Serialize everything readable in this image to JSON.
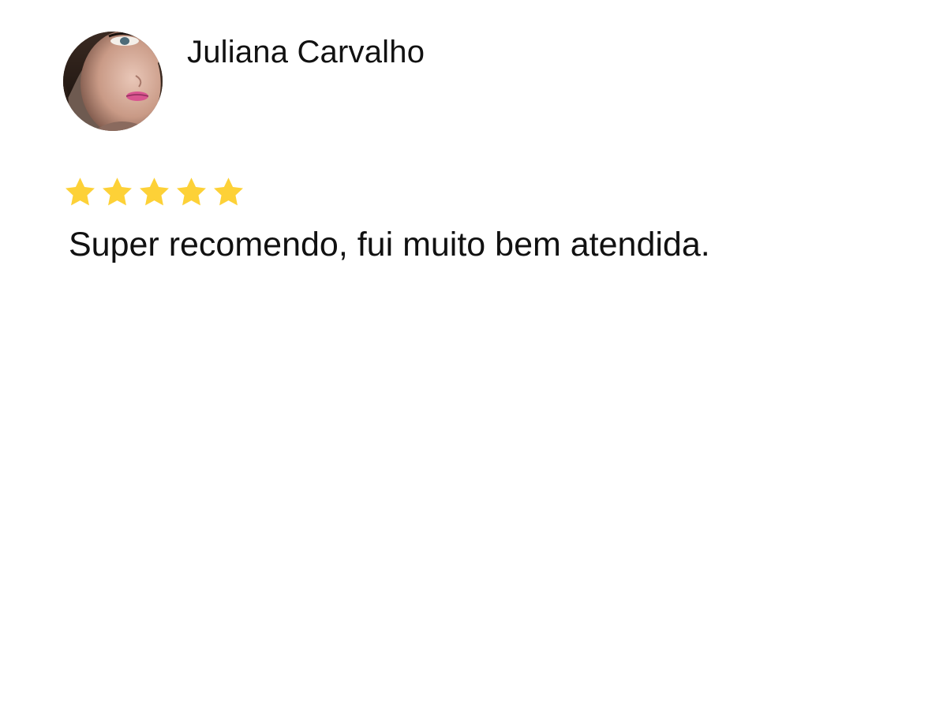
{
  "review": {
    "reviewer_name": "Juliana Carvalho",
    "avatar_icon": "reviewer-photo",
    "rating": 5,
    "rating_max": 5,
    "star_color": "#FDD137",
    "text": "Super recomendo, fui muito bem atendida."
  }
}
